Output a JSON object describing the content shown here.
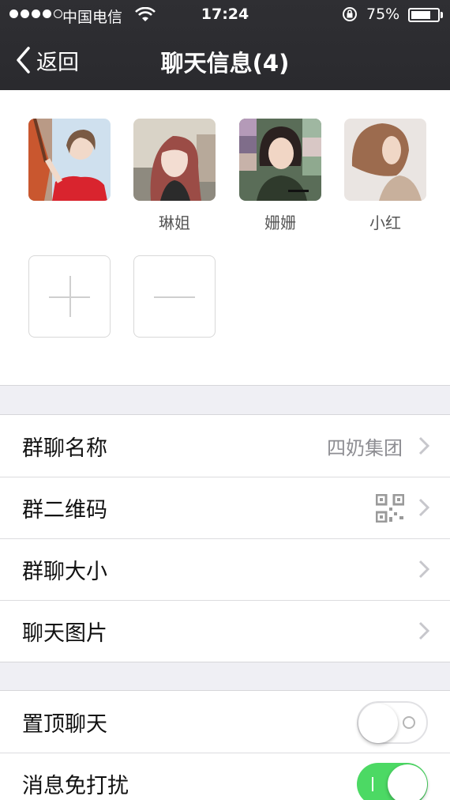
{
  "status_bar": {
    "carrier": "中国电信",
    "time": "17:24",
    "battery": "75%",
    "battery_level": 0.75
  },
  "nav": {
    "back_label": "返回",
    "title": "聊天信息(4)"
  },
  "members": [
    {
      "name": ""
    },
    {
      "name": "琳姐"
    },
    {
      "name": "姗姗"
    },
    {
      "name": "小红"
    }
  ],
  "settings_group_1": [
    {
      "label": "群聊名称",
      "value": "四奶集团"
    },
    {
      "label": "群二维码",
      "value": ""
    },
    {
      "label": "群聊大小",
      "value": ""
    },
    {
      "label": "聊天图片",
      "value": ""
    }
  ],
  "settings_group_2": [
    {
      "label": "置顶聊天",
      "toggle": false
    },
    {
      "label": "消息免打扰",
      "toggle": true
    }
  ],
  "colors": {
    "nav_bg": "#2d2d31",
    "toggle_on": "#4cd964",
    "page_bg": "#efeff4"
  }
}
